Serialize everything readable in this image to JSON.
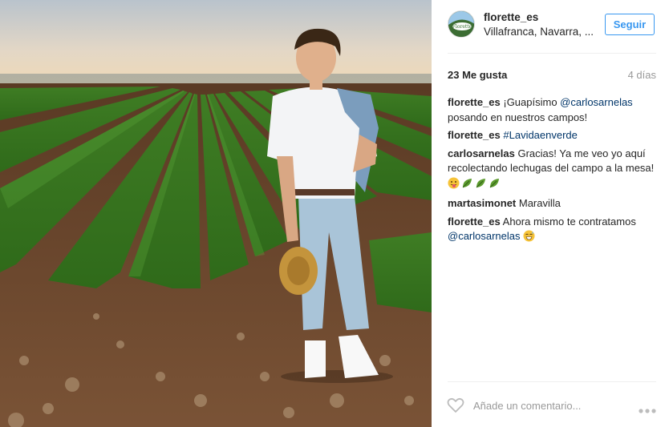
{
  "post": {
    "photo_description_icon": "post-photo",
    "account": {
      "username": "florette_es",
      "location": "Villafranca, Navarra, ...",
      "follow_label": "Seguir",
      "avatar_icon": "florette-logo",
      "avatar_text": "Florette"
    },
    "likes": "23 Me gusta",
    "age": "4 días",
    "comments": [
      {
        "user": "florette_es",
        "text": " ¡Guapísimo ",
        "mention": "@carlosarnelas",
        "after": " posando en nuestros campos!",
        "emojis": []
      },
      {
        "user": "florette_es",
        "text": " ",
        "mention": "#Lavidaenverde",
        "after": "",
        "emojis": []
      },
      {
        "user": "carlosarnelas",
        "text": " Gracias! Ya me veo yo aquí recolectando lechugas del campo a la mesa! ",
        "mention": "",
        "after": "",
        "emojis": [
          "tongue-face-emoji",
          "leaf-emoji",
          "leaf-emoji",
          "leaf-emoji"
        ]
      },
      {
        "user": "martasimonet",
        "text": " Maravilla",
        "mention": "",
        "after": "",
        "emojis": []
      },
      {
        "user": "florette_es",
        "text": " Ahora mismo te contratamos ",
        "mention": "@carlosarnelas",
        "after": " ",
        "emojis": [
          "grinning-sweat-emoji"
        ]
      }
    ],
    "add_comment_placeholder": "Añade un comentario...",
    "colors": {
      "accent": "#3897f0",
      "link": "#003569",
      "muted": "#999999",
      "text": "#262626"
    }
  }
}
